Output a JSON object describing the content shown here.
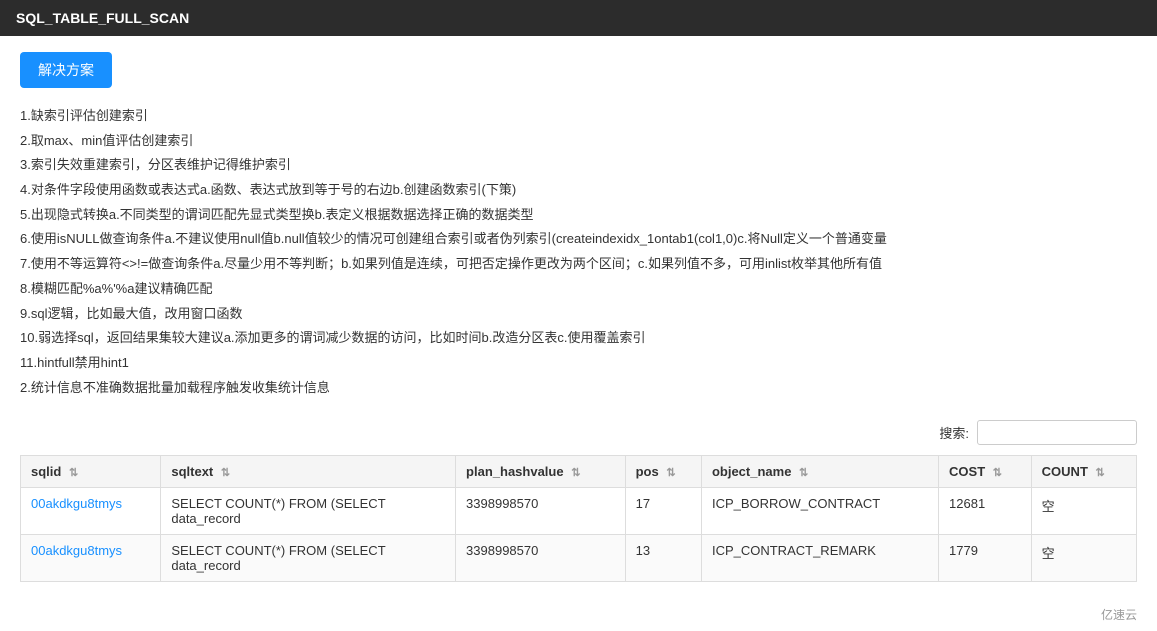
{
  "header": {
    "title": "SQL_TABLE_FULL_SCAN"
  },
  "toolbar": {
    "solve_button_label": "解决方案"
  },
  "solutions": [
    "1.缺索引评估创建索引",
    "2.取max、min值评估创建索引",
    "3.索引失效重建索引，分区表维护记得维护索引",
    "4.对条件字段使用函数或表达式a.函数、表达式放到等于号的右边b.创建函数索引(下策)",
    "5.出现隐式转换a.不同类型的谓词匹配先显式类型换b.表定义根据数据选择正确的数据类型",
    "6.使用isNULL做查询条件a.不建议使用null值b.null值较少的情况可创建组合索引或者伪列索引(createindexidx_1ontab1(col1,0)c.将Null定义一个普通变量",
    "7.使用不等运算符<>!=做查询条件a.尽量少用不等判断；b.如果列值是连续，可把否定操作更改为两个区间；c.如果列值不多，可用inlist枚举其他所有值",
    "8.模糊匹配%a%'%a建议精确匹配",
    "9.sql逻辑，比如最大值，改用窗口函数",
    "10.弱选择sql，返回结果集较大建议a.添加更多的谓词减少数据的访问，比如时间b.改造分区表c.使用覆盖索引",
    "11.hintfull禁用hint1",
    "2.统计信息不准确数据批量加载程序触发收集统计信息"
  ],
  "search": {
    "label": "搜索:",
    "placeholder": "",
    "value": ""
  },
  "table": {
    "columns": [
      {
        "id": "sqlid",
        "label": "sqlid",
        "sortable": true
      },
      {
        "id": "sqltext",
        "label": "sqltext",
        "sortable": true
      },
      {
        "id": "plan_hashvalue",
        "label": "plan_hashvalue",
        "sortable": true
      },
      {
        "id": "pos",
        "label": "pos",
        "sortable": true
      },
      {
        "id": "object_name",
        "label": "object_name",
        "sortable": true
      },
      {
        "id": "COST",
        "label": "COST",
        "sortable": true
      },
      {
        "id": "COUNT",
        "label": "COUNT",
        "sortable": true
      }
    ],
    "rows": [
      {
        "sqlid": "00akdkgu8tmys",
        "sqltext_line1": "SELECT COUNT(*) FROM (SELECT",
        "sqltext_line2": "data_record",
        "plan_hashvalue": "3398998570",
        "pos": "17",
        "object_name": "ICP_BORROW_CONTRACT",
        "cost": "12681",
        "count": "空"
      },
      {
        "sqlid": "00akdkgu8tmys",
        "sqltext_line1": "SELECT COUNT(*) FROM (SELECT",
        "sqltext_line2": "data_record",
        "plan_hashvalue": "3398998570",
        "pos": "13",
        "object_name": "ICP_CONTRACT_REMARK",
        "cost": "1779",
        "count": "空"
      }
    ]
  },
  "footer": {
    "brand": "亿速云"
  }
}
